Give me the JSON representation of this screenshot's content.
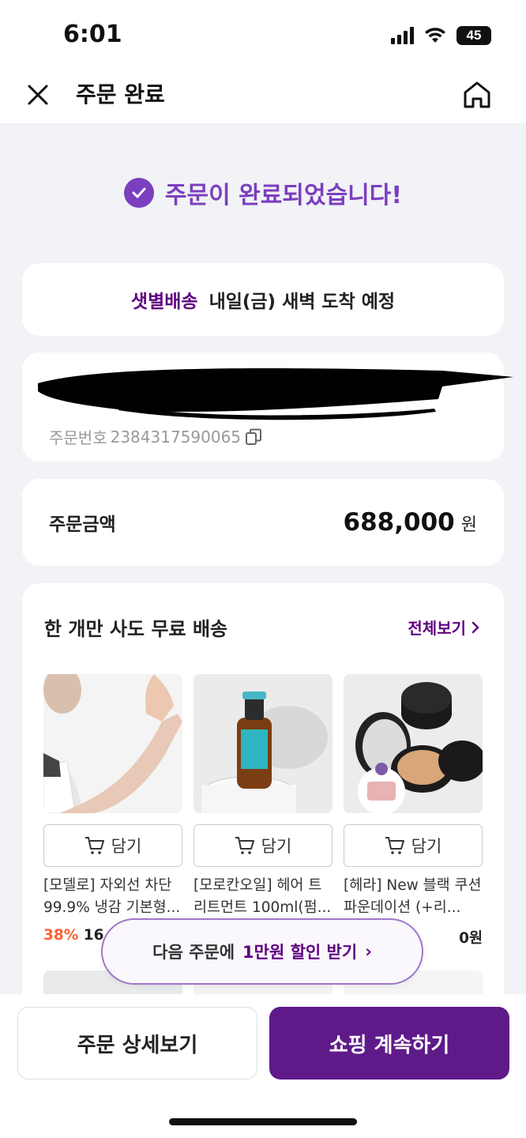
{
  "status_bar": {
    "time": "6:01",
    "battery": "45"
  },
  "header": {
    "title": "주문 완료",
    "close_icon": "close-icon",
    "home_icon": "home-icon"
  },
  "completion": {
    "message": "주문이 완료되었습니다!",
    "icon": "check-circle-icon"
  },
  "delivery": {
    "type": "샛별배송",
    "arrival": "내일(금) 새벽 도착 예정"
  },
  "order": {
    "number_label": "주문번호",
    "number": "2384317590065",
    "copy_icon": "copy-icon"
  },
  "amount": {
    "label": "주문금액",
    "value": "688,000",
    "unit": "원"
  },
  "recommend": {
    "title": "한 개만 사도 무료 배송",
    "view_all": "전체보기",
    "products": [
      {
        "cart_label": "담기",
        "name": "[모델로] 자외선 차단 99.9% 냉감 기본형...",
        "discount": "38%",
        "price": "16,0"
      },
      {
        "cart_label": "담기",
        "name": "[모로칸오일] 헤어 트리트먼트 100ml(펌...",
        "discount": "",
        "price": ""
      },
      {
        "cart_label": "담기",
        "name": "[헤라] New 블랙 쿠션 파운데이션 (+리...",
        "discount": "",
        "price": "0원"
      }
    ]
  },
  "coupon": {
    "text": "다음 주문에",
    "highlight": "1만원 할인 받기",
    "arrow": "›"
  },
  "buttons": {
    "detail": "주문 상세보기",
    "continue": "쇼핑 계속하기"
  },
  "colors": {
    "accent": "#5f0080",
    "check": "#7b3fbf",
    "discount": "#fa622f"
  }
}
